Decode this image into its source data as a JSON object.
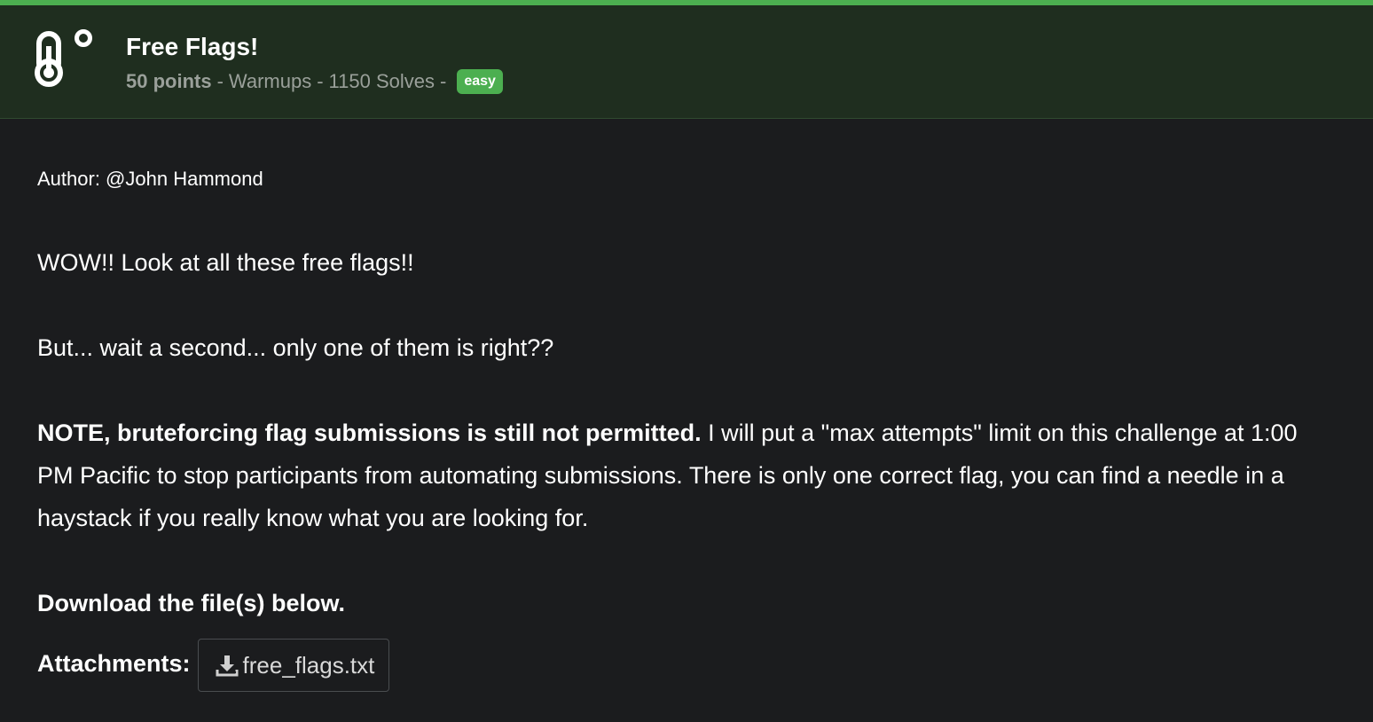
{
  "challenge": {
    "title": "Free Flags!",
    "points": "50 points",
    "category": "Warmups",
    "solves": "1150 Solves",
    "difficulty": "easy",
    "icon": "thermometer-icon"
  },
  "description": {
    "author": "Author: @John Hammond",
    "line1": "WOW!! Look at all these free flags!!",
    "line2": "But... wait a second... only one of them is right??",
    "note_bold": "NOTE, bruteforcing flag submissions is still not permitted.",
    "note_rest": " I will put a \"max attempts\" limit on this challenge at 1:00 PM Pacific to stop participants from automating submissions. There is only one correct flag, you can find a needle in a haystack if you really know what you are looking for.",
    "download_text": "Download the file(s) below."
  },
  "attachments": {
    "label": "Attachments:",
    "files": [
      {
        "name": "free_flags.txt",
        "icon": "download-icon"
      }
    ]
  },
  "colors": {
    "accent": "#4caf50",
    "header_bg": "#1f2e1f",
    "page_bg": "#1b1c1e",
    "muted_text": "#9aa09a"
  }
}
